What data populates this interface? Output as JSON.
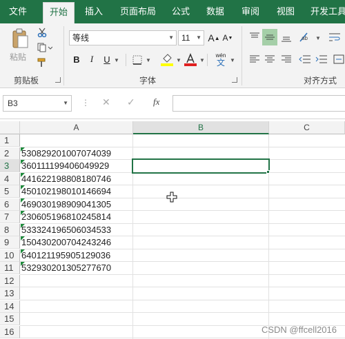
{
  "tabs": [
    {
      "label": "文件",
      "active": false
    },
    {
      "label": "开始",
      "active": true
    },
    {
      "label": "插入",
      "active": false
    },
    {
      "label": "页面布局",
      "active": false
    },
    {
      "label": "公式",
      "active": false
    },
    {
      "label": "数据",
      "active": false
    },
    {
      "label": "审阅",
      "active": false
    },
    {
      "label": "视图",
      "active": false
    },
    {
      "label": "开发工具",
      "active": false
    }
  ],
  "ribbon": {
    "clipboard": {
      "paste_label": "粘贴",
      "group_label": "剪贴板"
    },
    "font": {
      "name": "等线",
      "size": "11",
      "bold": "B",
      "italic": "I",
      "underline": "U",
      "grow": "A",
      "shrink": "A",
      "phonetic_top": "wén",
      "phonetic_bottom": "文",
      "group_label": "字体"
    },
    "alignment": {
      "group_label": "对齐方式"
    }
  },
  "formula_bar": {
    "name_box": "B3",
    "fx": "fx",
    "cancel": "✕",
    "enter": "✓",
    "value": ""
  },
  "sheet": {
    "columns": [
      "A",
      "B",
      "C"
    ],
    "selected_column": "B",
    "selected_cell": "B3",
    "rows": [
      "1",
      "2",
      "3",
      "4",
      "5",
      "6",
      "7",
      "8",
      "9",
      "10",
      "11",
      "12",
      "13",
      "14",
      "15",
      "16"
    ],
    "selected_row": "3",
    "column_a": {
      "2": "530829201007074039",
      "3": "360111199406049929",
      "4": "441622198808180746",
      "5": "450102198010146694",
      "6": "469030198909041305",
      "7": "230605196810245814",
      "8": "533324196506034533",
      "9": "150430200704243246",
      "10": "640121195905129036",
      "11": "532930201305277670"
    }
  },
  "watermark": "CSDN @ffcell2016",
  "colors": {
    "accent": "#217346",
    "error_indicator": "#1e8a3c"
  }
}
